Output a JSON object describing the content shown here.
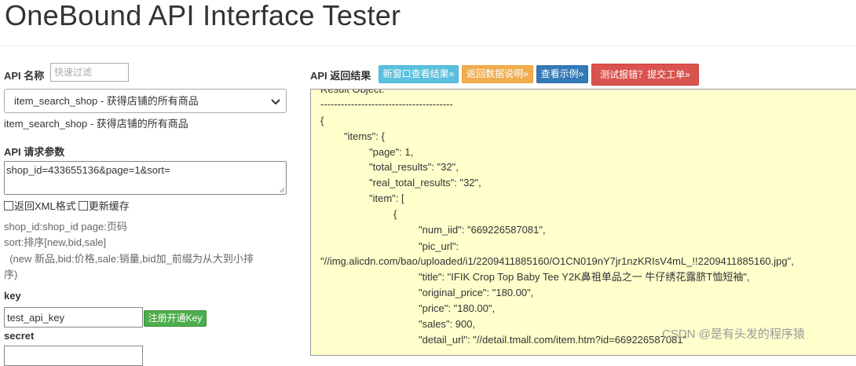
{
  "header": {
    "title": "OneBound API Interface Tester"
  },
  "api_name": {
    "label": "API 名称",
    "filter_placeholder": "快速过滤",
    "selected": "item_search_shop - 获得店铺的所有商品",
    "description": "item_search_shop - 获得店铺的所有商品"
  },
  "params": {
    "label": "API 请求参数",
    "value": "shop_id=433655136&page=1&sort=",
    "checkbox_xml": "返回XML格式",
    "checkbox_cache": "更新缓存",
    "help_line1": "shop_id:shop_id page:页码",
    "help_line2": "sort:排序[new,bid,sale]",
    "help_line3": "  (new 新品,bid:价格,sale:销量,bid加_前缀为从大到小排",
    "help_line4": "序)"
  },
  "key": {
    "label": "key",
    "value": "test_api_key",
    "register_button": "注册开通Key"
  },
  "secret": {
    "label": "secret"
  },
  "result": {
    "label": "API 返回结果",
    "btn_new_window": "新窗口查看结果»",
    "btn_return_doc": "返回数据说明»",
    "btn_example": "查看示例»",
    "btn_report": "测试报错？提交工单»",
    "lines": [
      "Result Object:",
      "---------------------------------------",
      "{",
      "\"items\": {",
      "\"page\": 1,",
      "\"total_results\": \"32\",",
      "\"real_total_results\": \"32\",",
      "\"item\": [",
      "{",
      "\"num_iid\": \"669226587081\",",
      "\"pic_url\":",
      "\"//img.alicdn.com/bao/uploaded/i1/2209411885160/O1CN019nY7jr1nzKRIsV4mL_!!2209411885160.jpg\",",
      "\"title\": \"IFIK Crop Top Baby Tee Y2K鼻祖单品之一 牛仔绣花露脐T恤短袖\",",
      "\"original_price\": \"180.00\",",
      "\"price\": \"180.00\",",
      "\"sales\": 900,",
      "\"detail_url\": \"//detail.tmall.com/item.htm?id=669226587081\""
    ]
  },
  "watermark": "CSDN @是有头发的程序猿"
}
